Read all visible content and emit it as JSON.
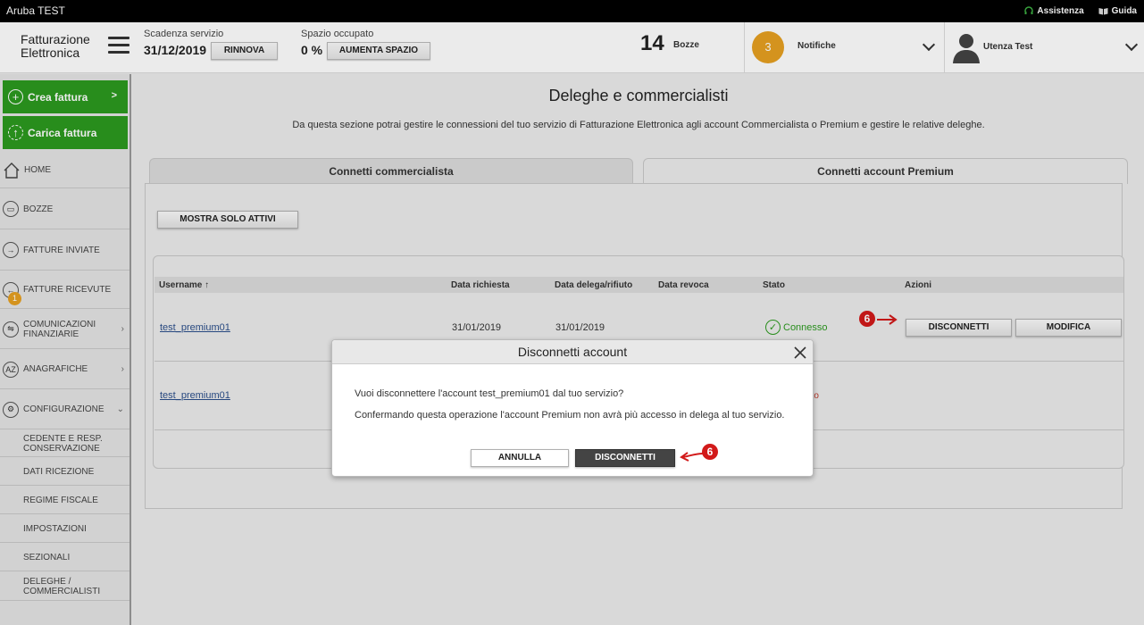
{
  "topbar": {
    "brand": "Aruba TEST",
    "assistenza": "Assistenza",
    "guida": "Guida"
  },
  "header": {
    "logo_line1": "Fatturazione",
    "logo_line2": "Elettronica",
    "scadenza_label": "Scadenza servizio",
    "scadenza_value": "31/12/2019",
    "rinnova": "RINNOVA",
    "spazio_label": "Spazio occupato",
    "spazio_value": "0 %",
    "aumenta": "AUMENTA SPAZIO",
    "bozze_count": "14",
    "bozze_label": "Bozze",
    "notifiche_count": "3",
    "notifiche_label": "Notifiche",
    "user_label": "Utenza Test"
  },
  "sidebar": {
    "crea": "Crea fattura",
    "carica": "Carica fattura",
    "items": [
      {
        "label": "HOME"
      },
      {
        "label": "BOZZE"
      },
      {
        "label": "FATTURE INVIATE"
      },
      {
        "label": "FATTURE RICEVUTE"
      },
      {
        "label": "COMUNICAZIONI FINANZIARIE"
      },
      {
        "label": "ANAGRAFICHE"
      },
      {
        "label": "CONFIGURAZIONE"
      }
    ],
    "ricevute_badge": "1",
    "sub_items": [
      {
        "label": "CEDENTE E RESP. CONSERVAZIONE"
      },
      {
        "label": "DATI RICEZIONE"
      },
      {
        "label": "REGIME FISCALE"
      },
      {
        "label": "IMPOSTAZIONI"
      },
      {
        "label": "SEZIONALI"
      },
      {
        "label": "DELEGHE / COMMERCIALISTI"
      }
    ]
  },
  "main": {
    "title": "Deleghe e commercialisti",
    "description": "Da questa sezione potrai gestire le connessioni del tuo servizio di Fatturazione Elettronica agli account Commercialista o Premium e gestire le relative deleghe.",
    "tabs": [
      {
        "label": "Connetti commercialista"
      },
      {
        "label": "Connetti account Premium"
      }
    ],
    "mostra_btn": "MOSTRA SOLO ATTIVI",
    "columns": [
      "Username",
      "Data richiesta",
      "Data delega/rifiuto",
      "Data revoca",
      "Stato",
      "Azioni"
    ],
    "sort_indicator": "↑",
    "rows": [
      {
        "username": "test_premium01",
        "richiesta": "31/01/2019",
        "delega": "31/01/2019",
        "stato": "Connesso",
        "btn1": "DISCONNETTI",
        "btn2": "MODIFICA"
      },
      {
        "username": "test_premium01",
        "stato_partial": "ato"
      }
    ]
  },
  "modal": {
    "title": "Disconnetti account",
    "line1": "Vuoi disconnettere l'account test_premium01 dal tuo servizio?",
    "line2": "Confermando questa operazione l'account Premium non avrà più accesso in delega al tuo servizio.",
    "annulla": "ANNULLA",
    "disconnetti": "DISCONNETTI"
  },
  "annotations": {
    "step": "6"
  },
  "colors": {
    "accent_green": "#2c9a1f",
    "badge_orange": "#e6a021",
    "annotation_red": "#d21a1a"
  }
}
